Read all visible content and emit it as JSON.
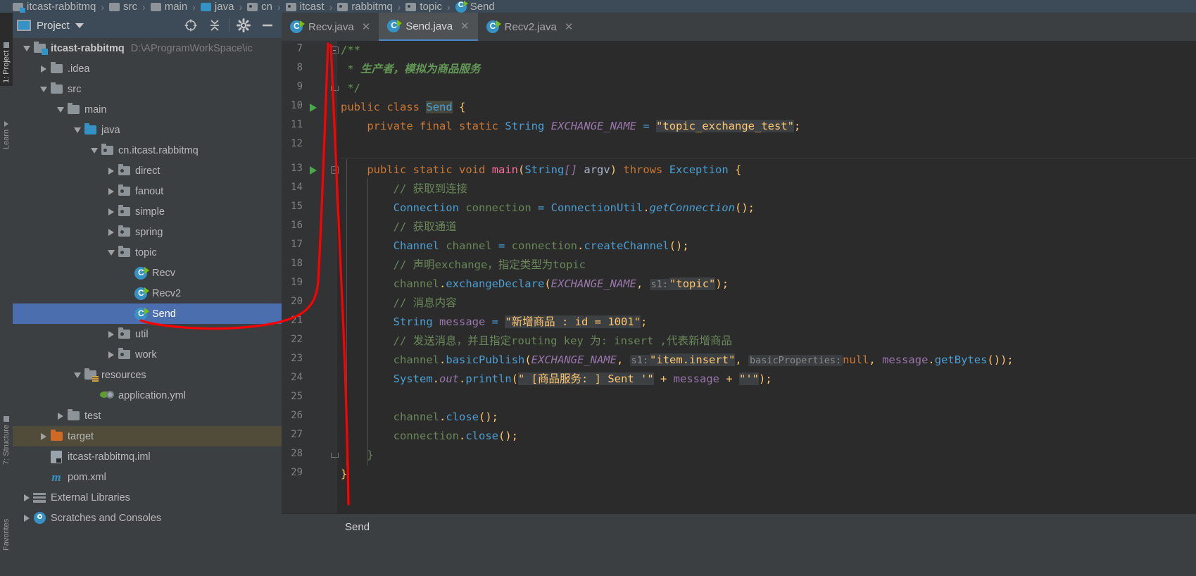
{
  "breadcrumb": {
    "items": [
      {
        "label": "itcast-rabbitmq",
        "icon": "module-icon"
      },
      {
        "label": "src",
        "icon": "folder-icon"
      },
      {
        "label": "main",
        "icon": "folder-icon"
      },
      {
        "label": "java",
        "icon": "source-root-icon"
      },
      {
        "label": "cn",
        "icon": "package-icon"
      },
      {
        "label": "itcast",
        "icon": "package-icon"
      },
      {
        "label": "rabbitmq",
        "icon": "package-icon"
      },
      {
        "label": "topic",
        "icon": "package-icon"
      },
      {
        "label": "Send",
        "icon": "java-class-icon"
      }
    ],
    "separator": "›"
  },
  "left_tool_strip": {
    "tabs": [
      {
        "label": "1: Project",
        "active": true
      },
      {
        "label": "Learn",
        "active": false
      },
      {
        "label": "7: Structure",
        "active": false
      },
      {
        "label": "Favorites",
        "active": false
      }
    ]
  },
  "project_panel": {
    "toolbar": {
      "title": "Project",
      "dropdown_icon": "chevron-down-icon",
      "buttons": [
        {
          "name": "locate-icon",
          "glyph": "⊕"
        },
        {
          "name": "collapse-all-icon",
          "glyph": "⥤"
        },
        {
          "name": "settings-gear-icon",
          "glyph": "⚙"
        },
        {
          "name": "hide-panel-icon",
          "glyph": "—"
        }
      ]
    },
    "tree": [
      {
        "label": "itcast-rabbitmq",
        "sublabel": "D:\\AProgramWorkSpace\\ic",
        "depth": 0,
        "expander": "down",
        "icon": "module",
        "bold": true,
        "state": "normal"
      },
      {
        "label": ".idea",
        "sublabel": "",
        "depth": 1,
        "expander": "right",
        "icon": "folder",
        "bold": false,
        "state": "normal"
      },
      {
        "label": "src",
        "sublabel": "",
        "depth": 1,
        "expander": "down",
        "icon": "folder",
        "bold": false,
        "state": "normal"
      },
      {
        "label": "main",
        "sublabel": "",
        "depth": 2,
        "expander": "down",
        "icon": "folder",
        "bold": false,
        "state": "normal"
      },
      {
        "label": "java",
        "sublabel": "",
        "depth": 3,
        "expander": "down",
        "icon": "folder-blue",
        "bold": false,
        "state": "normal"
      },
      {
        "label": "cn.itcast.rabbitmq",
        "sublabel": "",
        "depth": 4,
        "expander": "down",
        "icon": "package",
        "bold": false,
        "state": "normal"
      },
      {
        "label": "direct",
        "sublabel": "",
        "depth": 5,
        "expander": "right",
        "icon": "package",
        "bold": false,
        "state": "normal"
      },
      {
        "label": "fanout",
        "sublabel": "",
        "depth": 5,
        "expander": "right",
        "icon": "package",
        "bold": false,
        "state": "normal"
      },
      {
        "label": "simple",
        "sublabel": "",
        "depth": 5,
        "expander": "right",
        "icon": "package",
        "bold": false,
        "state": "normal"
      },
      {
        "label": "spring",
        "sublabel": "",
        "depth": 5,
        "expander": "right",
        "icon": "package",
        "bold": false,
        "state": "normal"
      },
      {
        "label": "topic",
        "sublabel": "",
        "depth": 5,
        "expander": "down",
        "icon": "package",
        "bold": false,
        "state": "normal"
      },
      {
        "label": "Recv",
        "sublabel": "",
        "depth": 6,
        "expander": "none",
        "icon": "class",
        "bold": false,
        "state": "normal"
      },
      {
        "label": "Recv2",
        "sublabel": "",
        "depth": 6,
        "expander": "none",
        "icon": "class",
        "bold": false,
        "state": "normal"
      },
      {
        "label": "Send",
        "sublabel": "",
        "depth": 6,
        "expander": "none",
        "icon": "class",
        "bold": false,
        "state": "selected"
      },
      {
        "label": "util",
        "sublabel": "",
        "depth": 5,
        "expander": "right",
        "icon": "package",
        "bold": false,
        "state": "normal"
      },
      {
        "label": "work",
        "sublabel": "",
        "depth": 5,
        "expander": "right",
        "icon": "package",
        "bold": false,
        "state": "normal"
      },
      {
        "label": "resources",
        "sublabel": "",
        "depth": 3,
        "expander": "down",
        "icon": "resources",
        "bold": false,
        "state": "normal"
      },
      {
        "label": "application.yml",
        "sublabel": "",
        "depth": 4,
        "expander": "none",
        "icon": "yml",
        "bold": false,
        "state": "normal"
      },
      {
        "label": "test",
        "sublabel": "",
        "depth": 2,
        "expander": "right",
        "icon": "folder",
        "bold": false,
        "state": "normal"
      },
      {
        "label": "target",
        "sublabel": "",
        "depth": 1,
        "expander": "right",
        "icon": "folder-orange",
        "bold": false,
        "state": "highlight"
      },
      {
        "label": "itcast-rabbitmq.iml",
        "sublabel": "",
        "depth": 1,
        "expander": "none",
        "icon": "iml",
        "bold": false,
        "state": "normal"
      },
      {
        "label": "pom.xml",
        "sublabel": "",
        "depth": 1,
        "expander": "none",
        "icon": "maven",
        "bold": false,
        "state": "normal"
      },
      {
        "label": "External Libraries",
        "sublabel": "",
        "depth": 0,
        "expander": "right",
        "icon": "library",
        "bold": false,
        "state": "normal"
      },
      {
        "label": "Scratches and Consoles",
        "sublabel": "",
        "depth": 0,
        "expander": "right",
        "icon": "scratch",
        "bold": false,
        "state": "normal"
      }
    ]
  },
  "editor": {
    "tabs": [
      {
        "label": "Recv.java",
        "active": false,
        "close_icon": "close-icon"
      },
      {
        "label": "Send.java",
        "active": true,
        "close_icon": "close-icon"
      },
      {
        "label": "Recv2.java",
        "active": false,
        "close_icon": "close-icon"
      }
    ],
    "first_line_number": 7,
    "line_numbers": [
      7,
      8,
      9,
      10,
      11,
      12,
      13,
      14,
      15,
      16,
      17,
      18,
      19,
      20,
      21,
      22,
      23,
      24,
      25,
      26,
      27,
      28,
      29
    ],
    "lines": [
      {
        "n": 7,
        "text": "/**"
      },
      {
        "n": 8,
        "text": " * 生产者，模拟为商品服务"
      },
      {
        "n": 9,
        "text": " */"
      },
      {
        "n": 10,
        "text": "public class Send {"
      },
      {
        "n": 11,
        "text": "    private final static String EXCHANGE_NAME = \"topic_exchange_test\";"
      },
      {
        "n": 12,
        "text": ""
      },
      {
        "n": 13,
        "text": "    public static void main(String[] argv) throws Exception {"
      },
      {
        "n": 14,
        "text": "        // 获取到连接"
      },
      {
        "n": 15,
        "text": "        Connection connection = ConnectionUtil.getConnection();"
      },
      {
        "n": 16,
        "text": "        // 获取通道"
      },
      {
        "n": 17,
        "text": "        Channel channel = connection.createChannel();"
      },
      {
        "n": 18,
        "text": "        // 声明exchange，指定类型为topic"
      },
      {
        "n": 19,
        "text": "        channel.exchangeDeclare(EXCHANGE_NAME, \"topic\");"
      },
      {
        "n": 20,
        "text": "        // 消息内容"
      },
      {
        "n": 21,
        "text": "        String message = \"新增商品 : id = 1001\";"
      },
      {
        "n": 22,
        "text": "        // 发送消息，并且指定routing key 为: insert ,代表新增商品"
      },
      {
        "n": 23,
        "text": "        channel.basicPublish(EXCHANGE_NAME, \"item.insert\", null, message.getBytes());"
      },
      {
        "n": 24,
        "text": "        System.out.println(\" [商品服务: ] Sent '\" + message + \"'\");"
      },
      {
        "n": 25,
        "text": ""
      },
      {
        "n": 26,
        "text": "        channel.close();"
      },
      {
        "n": 27,
        "text": "        connection.close();"
      },
      {
        "n": 28,
        "text": "    }"
      },
      {
        "n": 29,
        "text": "}"
      }
    ],
    "param_hints": {
      "s1_a": "s1:",
      "s1_b": "s1:",
      "basic_props": "basicProperties:"
    },
    "tokens": {
      "jdoc_open": "/**",
      "jdoc_star": " * ",
      "jdoc_text": "生产者，模拟为商品服务",
      "jdoc_close": " */",
      "kw_public": "public",
      "kw_class": "class",
      "cls_send": "Send",
      "kw_private": "private",
      "kw_final": "final",
      "kw_static": "static",
      "ty_string": "String",
      "fld_exchange": "EXCHANGE_NAME",
      "str_exchange": "\"topic_exchange_test\"",
      "kw_void": "void",
      "m_main": "main",
      "arg_argv": "argv",
      "kw_throws": "throws",
      "ty_exception": "Exception",
      "c_conn": "// 获取到连接",
      "ty_connection": "Connection",
      "var_connection": "connection",
      "ty_connutil": "ConnectionUtil",
      "m_getconn": "getConnection",
      "c_channel": "// 获取通道",
      "ty_channel": "Channel",
      "var_channel": "channel",
      "m_createchannel": "createChannel",
      "c_exchange": "// 声明exchange，指定类型为topic",
      "m_exchangedeclare": "exchangeDeclare",
      "str_topic": "\"topic\"",
      "c_msgcontent": "// 消息内容",
      "var_message": "message",
      "str_message": "\"新增商品 : id = 1001\"",
      "c_routing": "// 发送消息，并且指定routing key 为: insert ,代表新增商品",
      "m_basicpublish": "basicPublish",
      "str_iteminsert": "\"item.insert\"",
      "kw_null": "null",
      "m_getbytes": "getBytes",
      "ty_system": "System",
      "fld_out": "out",
      "m_println": "println",
      "str_sent": "\" [商品服务: ] Sent '\"",
      "str_quote": "\"'\"",
      "m_close": "close"
    }
  },
  "status_bar": {
    "run_label": "Send"
  },
  "annotation": {
    "color": "#ff0000",
    "type": "hand-drawn-arrow"
  },
  "colors": {
    "panel_bg": "#3c3f41",
    "editor_bg": "#2b2b2b",
    "gutter_bg": "#313335",
    "selection_blue": "#4b6eaf",
    "accent_blue": "#3592c4",
    "tab_active": "#4e5254",
    "toolbar_blue": "#3c4b57",
    "target_highlight": "#514c3a"
  }
}
